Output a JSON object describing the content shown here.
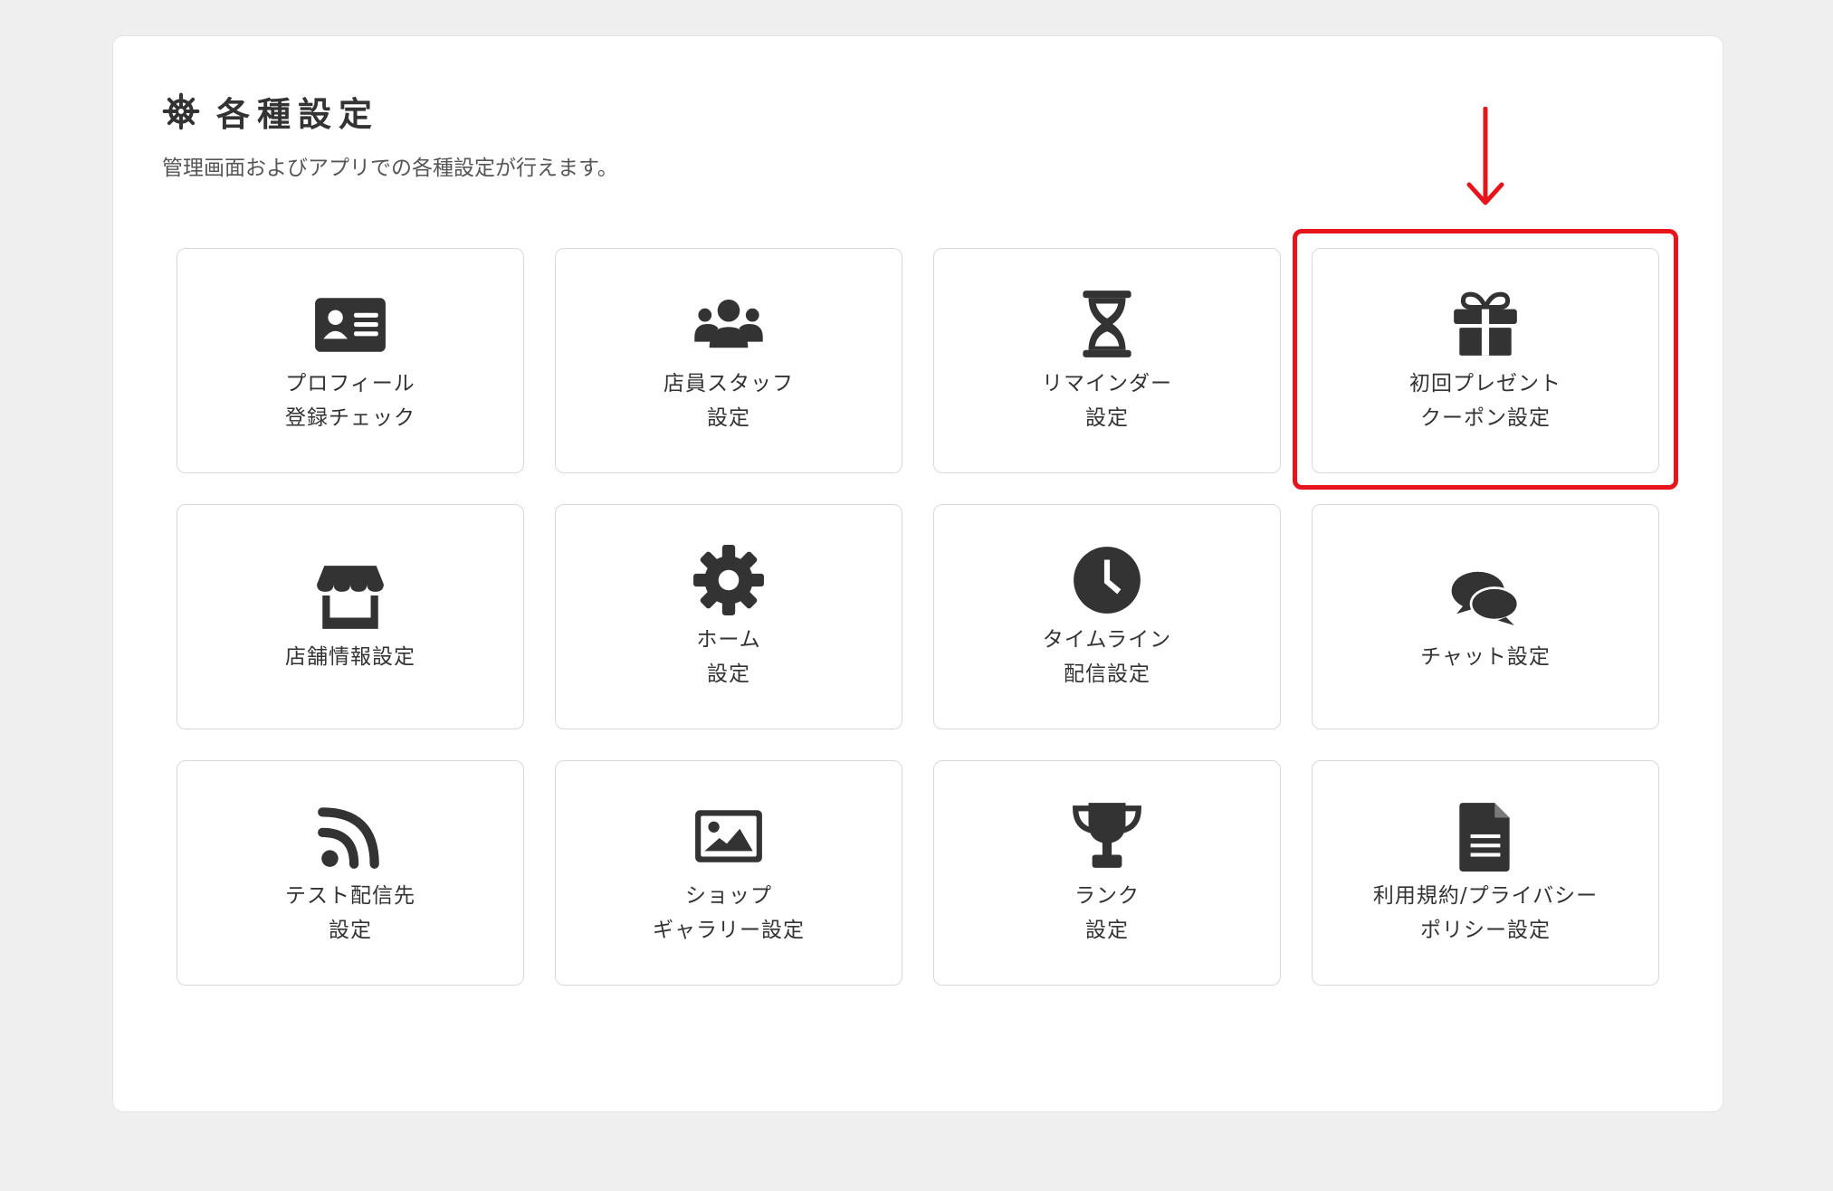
{
  "page": {
    "title": "各種設定",
    "subtitle": "管理画面およびアプリでの各種設定が行えます。",
    "title_icon": "helm-icon"
  },
  "cards": [
    {
      "icon": "id-card-icon",
      "line1": "プロフィール",
      "line2": "登録チェック"
    },
    {
      "icon": "users-icon",
      "line1": "店員スタッフ",
      "line2": "設定"
    },
    {
      "icon": "hourglass-icon",
      "line1": "リマインダー",
      "line2": "設定"
    },
    {
      "icon": "gift-icon",
      "line1": "初回プレゼント",
      "line2": "クーポン設定"
    },
    {
      "icon": "store-icon",
      "line1": "店舗情報設定",
      "line2": ""
    },
    {
      "icon": "gear-icon",
      "line1": "ホーム",
      "line2": "設定"
    },
    {
      "icon": "clock-icon",
      "line1": "タイムライン",
      "line2": "配信設定"
    },
    {
      "icon": "chat-icon",
      "line1": "チャット設定",
      "line2": ""
    },
    {
      "icon": "rss-icon",
      "line1": "テスト配信先",
      "line2": "設定"
    },
    {
      "icon": "image-icon",
      "line1": "ショップ",
      "line2": "ギャラリー設定"
    },
    {
      "icon": "trophy-icon",
      "line1": "ランク",
      "line2": "設定"
    },
    {
      "icon": "document-icon",
      "line1": "利用規約/プライバシー",
      "line2": "ポリシー設定"
    }
  ],
  "annotation": {
    "highlight_color": "#e8141c",
    "highlighted_card": "初回プレゼント クーポン設定"
  },
  "colors": {
    "background": "#efefef",
    "panel": "#ffffff",
    "icon": "#333333",
    "text": "#333333",
    "card_border": "#d9d9d9"
  }
}
